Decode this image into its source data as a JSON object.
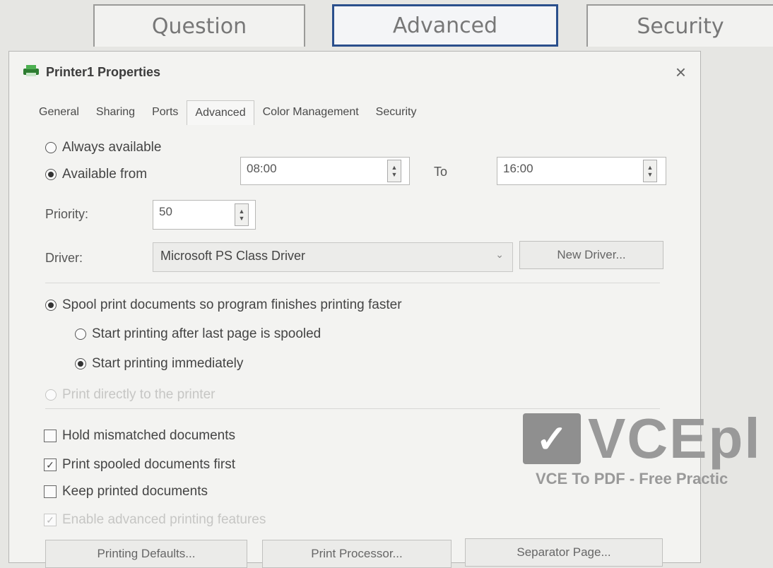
{
  "outer_tabs": [
    "Question",
    "Advanced",
    "Security"
  ],
  "dialog": {
    "title": "Printer1 Properties",
    "close": "×",
    "tabs": [
      "General",
      "Sharing",
      "Ports",
      "Advanced",
      "Color Management",
      "Security"
    ],
    "active_tab": "Advanced"
  },
  "availability": {
    "always": "Always available",
    "from": "Available from",
    "from_value": "08:00",
    "to_label": "To",
    "to_value": "16:00"
  },
  "priority": {
    "label": "Priority:",
    "value": "50"
  },
  "driver": {
    "label": "Driver:",
    "value": "Microsoft PS Class Driver",
    "new_button": "New Driver..."
  },
  "spool": {
    "option": "Spool print documents so program finishes printing faster",
    "after_last": "Start printing after last page is spooled",
    "immediately": "Start printing immediately",
    "direct": "Print directly to the printer"
  },
  "checks": {
    "hold": "Hold mismatched documents",
    "spooled_first": "Print spooled documents first",
    "keep": "Keep printed documents",
    "advanced": "Enable advanced printing features"
  },
  "buttons": {
    "defaults": "Printing Defaults...",
    "processor": "Print Processor...",
    "separator": "Separator Page..."
  },
  "watermark": {
    "logo": "✓",
    "name": "VCEpl",
    "tagline": "VCE To PDF - Free Practic"
  },
  "icons": {
    "printer": "printer-icon",
    "close": "close-icon",
    "spin": "spinner-arrows-icon",
    "dropdown": "chevron-down-icon",
    "check": "check-mark-icon"
  }
}
